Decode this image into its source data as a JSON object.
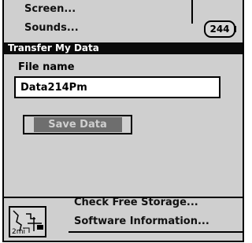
{
  "background_menu": {
    "items": [
      "Screen...",
      "Sounds..."
    ],
    "badge": "244"
  },
  "dialog": {
    "title": "Transfer My Data",
    "field_label": "File name",
    "file_name_value": "Data214Pm",
    "save_label": "Save Data"
  },
  "bottom_menu": {
    "items": [
      "Check Free Storage...",
      "Software Information..."
    ]
  },
  "map_thumbnail": {
    "scale_label": "2mi"
  }
}
